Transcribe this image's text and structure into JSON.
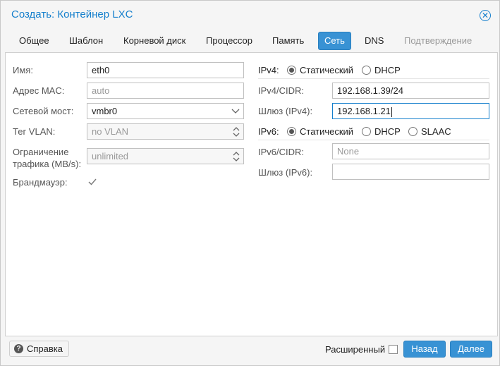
{
  "window": {
    "title": "Создать: Контейнер LXC"
  },
  "tabs": [
    {
      "label": "Общее"
    },
    {
      "label": "Шаблон"
    },
    {
      "label": "Корневой диск"
    },
    {
      "label": "Процессор"
    },
    {
      "label": "Память"
    },
    {
      "label": "Сеть"
    },
    {
      "label": "DNS"
    },
    {
      "label": "Подтверждение"
    }
  ],
  "active_tab": "Сеть",
  "left_form": {
    "name_label": "Имя:",
    "name_value": "eth0",
    "mac_label": "Адрес MAC:",
    "mac_placeholder": "auto",
    "bridge_label": "Сетевой мост:",
    "bridge_value": "vmbr0",
    "vlan_label": "Тег VLAN:",
    "vlan_placeholder": "no VLAN",
    "rate_label_line1": "Ограничение",
    "rate_label_line2": "трафика (MB/s):",
    "rate_placeholder": "unlimited",
    "firewall_label": "Брандмауэр:",
    "firewall_checked": true
  },
  "right_form": {
    "ipv4_label": "IPv4:",
    "ipv4_static": "Статический",
    "ipv4_dhcp": "DHCP",
    "ipv4_mode": "static",
    "ipv4_cidr_label": "IPv4/CIDR:",
    "ipv4_cidr_value": "192.168.1.39/24",
    "gw4_label": "Шлюз (IPv4):",
    "gw4_value": "192.168.1.21",
    "ipv6_label": "IPv6:",
    "ipv6_static": "Статический",
    "ipv6_dhcp": "DHCP",
    "ipv6_slaac": "SLAAC",
    "ipv6_mode": "static",
    "ipv6_cidr_label": "IPv6/CIDR:",
    "ipv6_cidr_placeholder": "None",
    "gw6_label": "Шлюз (IPv6):",
    "gw6_value": ""
  },
  "footer": {
    "help_label": "Справка",
    "advanced_label": "Расширенный",
    "advanced_checked": false,
    "back_label": "Назад",
    "next_label": "Далее"
  },
  "colors": {
    "accent": "#157fcc",
    "button": "#3892d4"
  }
}
